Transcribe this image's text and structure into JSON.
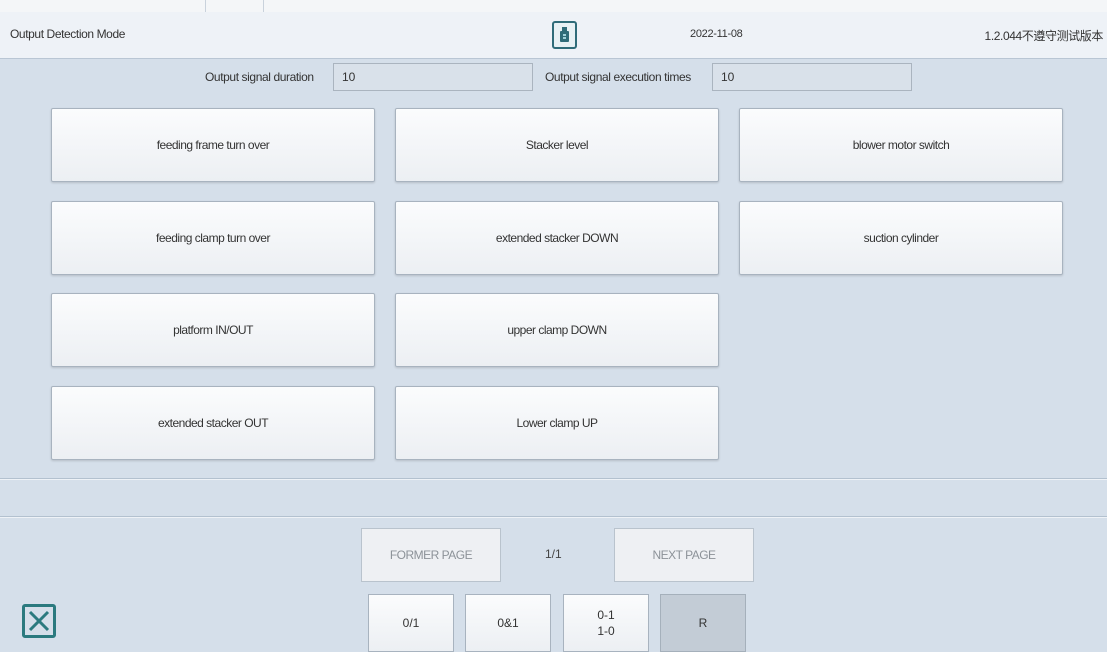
{
  "header": {
    "title": "Output Detection Mode",
    "date": "2022-11-08",
    "version": "1.2.044不遵守测试版本",
    "usb_icon": "usb-drive-icon"
  },
  "fields": {
    "duration_label": "Output signal duration",
    "duration_value": "10",
    "times_label": "Output signal execution times",
    "times_value": "10"
  },
  "buttons": [
    "feeding frame turn over",
    "Stacker level",
    "blower motor switch",
    "feeding clamp turn over",
    "extended stacker DOWN",
    "suction cylinder",
    "platform IN/OUT",
    "upper clamp DOWN",
    "extended stacker OUT",
    "Lower clamp UP"
  ],
  "pagination": {
    "former": "FORMER PAGE",
    "indicator": "1/1",
    "next": "NEXT PAGE"
  },
  "modes": [
    {
      "label": "0/1"
    },
    {
      "label": "0&1"
    },
    {
      "line1": "0-1",
      "line2": "1-0"
    },
    {
      "label": "R",
      "active": true
    }
  ],
  "colors": {
    "background": "#d5dfea",
    "icon_accent": "#2b7a7f"
  },
  "close_icon": "close-x-icon"
}
